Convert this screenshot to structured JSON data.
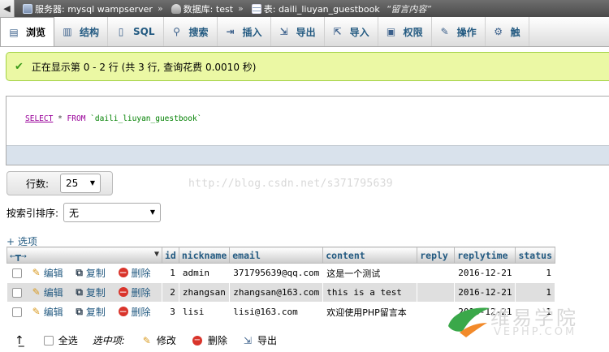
{
  "breadcrumb": {
    "server_label": "服务器: mysql wampserver",
    "db_label": "数据库: test",
    "table_label": "表: daili_liuyan_guestbook",
    "table_comment": "“留言内容”"
  },
  "tabs": [
    {
      "label": "浏览",
      "icon": "browse-icon"
    },
    {
      "label": "结构",
      "icon": "structure-icon"
    },
    {
      "label": "SQL",
      "icon": "sql-icon"
    },
    {
      "label": "搜索",
      "icon": "search-icon"
    },
    {
      "label": "插入",
      "icon": "insert-icon"
    },
    {
      "label": "导出",
      "icon": "export-icon"
    },
    {
      "label": "导入",
      "icon": "import-icon"
    },
    {
      "label": "权限",
      "icon": "privileges-icon"
    },
    {
      "label": "操作",
      "icon": "operations-icon"
    },
    {
      "label": "触",
      "icon": "triggers-icon"
    }
  ],
  "message": "正在显示第 0 - 2 行 (共 3 行, 查询花费 0.0010 秒)",
  "sql": {
    "select": "SELECT",
    "star": "*",
    "from": "FROM",
    "table": "`daili_liuyan_guestbook`"
  },
  "rows_control": {
    "label": "行数:",
    "value": "25"
  },
  "sort": {
    "label": "按索引排序:",
    "value": "无"
  },
  "options_link": "+ 选项",
  "watermark": "http://blog.csdn.net/s371795639",
  "table": {
    "columns": [
      "id",
      "nickname",
      "email",
      "content",
      "reply",
      "replytime",
      "status"
    ],
    "actions": {
      "edit": "编辑",
      "copy": "复制",
      "delete": "删除"
    },
    "rows": [
      {
        "id": "1",
        "nickname": "admin",
        "email": "371795639@qq.com",
        "content": "这是一个测试",
        "reply": "",
        "replytime": "2016-12-21",
        "status": "1"
      },
      {
        "id": "2",
        "nickname": "zhangsan",
        "email": "zhangsan@163.com",
        "content": "this is a test",
        "reply": "",
        "replytime": "2016-12-21",
        "status": "1"
      },
      {
        "id": "3",
        "nickname": "lisi",
        "email": "lisi@163.com",
        "content": "欢迎使用PHP留言本",
        "reply": "",
        "replytime": "2016-12-21",
        "status": "1"
      }
    ]
  },
  "bottom": {
    "select_all": "全选",
    "with_selected": "选中项:",
    "edit": "修改",
    "delete": "删除",
    "export": "导出"
  },
  "logo": {
    "cn": "维易学院",
    "en": "VEPHP.COM"
  }
}
